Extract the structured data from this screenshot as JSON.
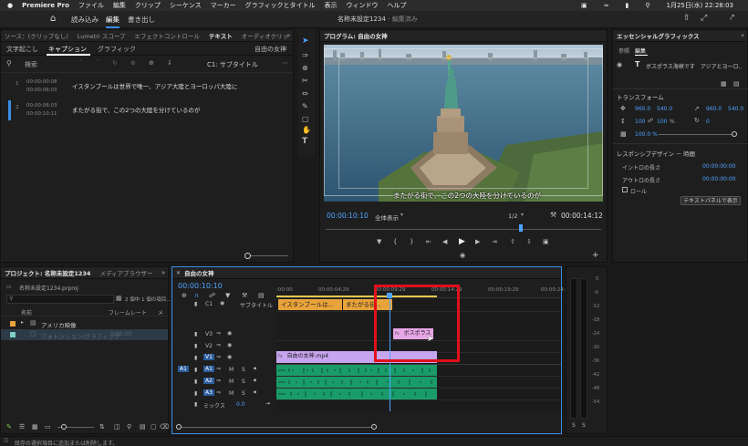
{
  "menubar": {
    "apple": "",
    "app": "Premiere Pro",
    "items": [
      "ファイル",
      "編集",
      "クリップ",
      "シーケンス",
      "マーカー",
      "グラフィックとタイトル",
      "表示",
      "ウィンドウ",
      "ヘルプ"
    ],
    "datetime": "1月25日(水) 22:28:03"
  },
  "header": {
    "tabs": [
      "読み込み",
      "編集",
      "書き出し"
    ],
    "title": "名称未設定1234",
    "title_suffix": " - 編集済み"
  },
  "source_panel": {
    "tabs": [
      "ソース：(クリップなし)",
      "Lumetri スコープ",
      "エフェクトコントロール",
      "テキスト",
      "オーディオクリッ"
    ],
    "subtabs": [
      "文字起こし",
      "キャプション",
      "グラフィック"
    ],
    "seq_name": "自由の女神",
    "search_placeholder": "検索",
    "track_label": "C1: サブタイトル",
    "captions": [
      {
        "index": "1",
        "in": "00:00:00:08",
        "out": "00:00:06:03",
        "text": "イスタンブールは世界で唯一、アジア大陸とヨーロッパ大陸に"
      },
      {
        "index": "2",
        "in": "00:00:06:03",
        "out": "00:00:10:11",
        "text": "またがる街で、この2つの大陸を分けているのが"
      }
    ]
  },
  "program_panel": {
    "title": "プログラム: 自由の女神",
    "subtitle_overlay": "またがる街で、この2つの大陸を分けているのが",
    "timecode": "00:00:10:10",
    "fit": "全体表示",
    "resolution": "1/2",
    "duration": "00:00:14:12"
  },
  "essential_graphics": {
    "title": "エッセンシャルグラフィックス",
    "tabs": [
      "参照",
      "編集"
    ],
    "layer_name": "ボスポラス海峡です　アジアとヨーロ..",
    "transform_label": "トランスフォーム",
    "pos_x": "960.0",
    "pos_y": "540.0",
    "anchor_x": "960.0",
    "anchor_y": "540.0",
    "scale_w": "100",
    "scale_h": "100",
    "scale_unit": "%",
    "rotation": "0",
    "opacity": "100.0 %",
    "responsive_label": "レスポンシブデザイン － 時間",
    "intro_label": "イントロの長さ",
    "intro_value": "00:00:00:00",
    "outro_label": "アウトロの長さ",
    "outro_value": "00:00:00:00",
    "roll_label": "ロール",
    "text_panel_button": "テキストパネルで表示"
  },
  "project_panel": {
    "tabs": [
      "プロジェクト: 名称未設定1234",
      "メディアブラウザー"
    ],
    "file": "名称未設定1234.prproj",
    "selection_info": "2 個中 1 個の項目...",
    "col_name": "名前",
    "col_framerate": "フレームレート",
    "col_media": "メ",
    "rows": [
      {
        "name": "アメリカ映像",
        "rate": ""
      },
      {
        "name": "フォトンション/グラフィック",
        "rate": "0/00.00"
      }
    ]
  },
  "timeline": {
    "title": "自由の女神",
    "timecode": "00:00:10:10",
    "ruler": [
      ":00:00",
      "00:00:04:29",
      "00:00:09:29",
      "00:00:14:29",
      "00:00:19:29",
      "00:00:24:29"
    ],
    "subtitle_track": "サブタイトル",
    "caption_clips": [
      "イスタンブールは...",
      "またがる街..."
    ],
    "tracks": [
      "V3",
      "V2",
      "V1",
      "A1",
      "A2",
      "A3"
    ],
    "c1": "C1",
    "src_a1": "A1",
    "m": "M",
    "s": "S",
    "mix_label": "ミックス",
    "mix_value": "0.0",
    "graphic_clip": "ボスポラス",
    "graphic_badge": "fx",
    "video_clip": "自由の女神.mp4",
    "video_badge": "fx"
  },
  "meters": {
    "scale": [
      "0",
      "-6",
      "-12",
      "-18",
      "-24",
      "-30",
      "-36",
      "-42",
      "-48",
      "-54"
    ],
    "s_labels": [
      "S",
      "S"
    ]
  },
  "status": {
    "text": "既存の選択項目に追加または削除します。"
  },
  "colors": {
    "accent": "#3a8ee6",
    "caption_clip": "#e8a33a",
    "graphic_clip": "#e7a6e6",
    "video_clip": "#c7a4ee",
    "audio_clip": "#1a9c6a",
    "highlight": "#e0101a"
  }
}
